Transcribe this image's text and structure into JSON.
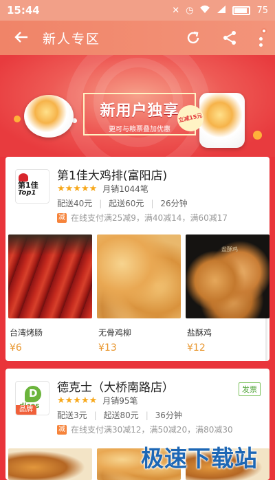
{
  "status_bar": {
    "time": "15:44",
    "icons": [
      "mute-icon",
      "alarm-icon",
      "wifi-icon",
      "signal-icon",
      "battery-icon"
    ],
    "battery_level": "75"
  },
  "nav": {
    "title": "新人专区",
    "back_icon": "back-arrow-icon",
    "refresh_icon": "refresh-icon",
    "share_icon": "share-icon",
    "more_icon": "more-vertical-icon"
  },
  "banner": {
    "title": "新用户独享",
    "subtitle": "更可与粮票叠加优惠",
    "stamp": "立减15元"
  },
  "shops": [
    {
      "name": "第1佳大鸡排(富阳店)",
      "logo_text_1": "第1佳",
      "logo_text_2": "Top1",
      "rating": "★★★★★",
      "monthly_sales": "月销1044笔",
      "delivery_fee": "配送40元",
      "min_order": "起送60元",
      "delivery_time": "26分钟",
      "promo_badge": "减",
      "promo_text": "在线支付满25减9，满40减14，满60减17",
      "dishes": [
        {
          "name": "台湾烤肠",
          "price": "¥6"
        },
        {
          "name": "无骨鸡柳",
          "price": "¥13"
        },
        {
          "name": "盐酥鸡",
          "price": "¥12"
        }
      ],
      "dish_image_label": "盐酥鸡"
    },
    {
      "name": "德克士（大桥南路店）",
      "logo_text": "dicos",
      "brand_tag": "品牌",
      "invoice_tag": "发票",
      "rating": "★★★★★",
      "monthly_sales": "月销95笔",
      "delivery_fee": "配送3元",
      "min_order": "起送80元",
      "delivery_time": "36分钟",
      "promo_badge": "减",
      "promo_text": "在线支付满30减12，满50减20，满80减30"
    }
  ],
  "watermark": "极速下载站",
  "colors": {
    "theme_red": "#e9343a",
    "nav_orange": "#f08468",
    "star": "#f7a81b",
    "price": "#e8952c",
    "promo_badge": "#f6833a"
  }
}
